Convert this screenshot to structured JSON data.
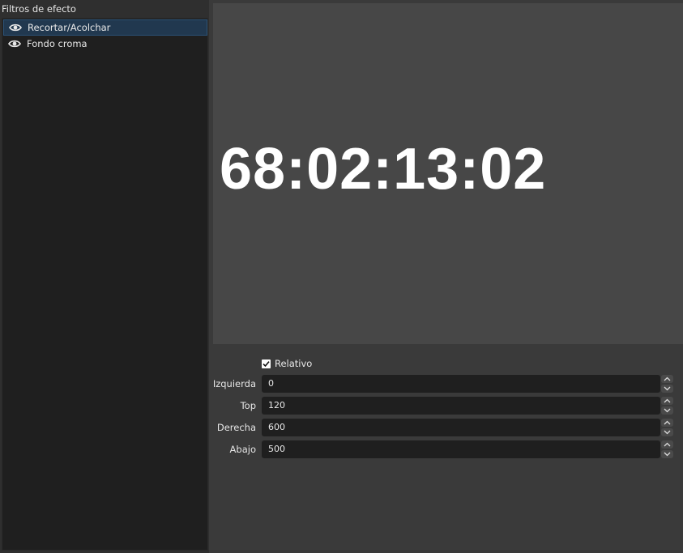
{
  "filters_panel": {
    "title": "Filtros de efecto",
    "items": [
      {
        "label": "Recortar/Acolchar",
        "selected": true,
        "icon": "eye-icon"
      },
      {
        "label": "Fondo croma",
        "selected": false,
        "icon": "eye-icon"
      }
    ]
  },
  "preview": {
    "timecode": "68:02:13:02"
  },
  "properties": {
    "relative": {
      "label": "Relativo",
      "checked": true
    },
    "fields": [
      {
        "label": "Izquierda",
        "value": "0"
      },
      {
        "label": "Top",
        "value": "120"
      },
      {
        "label": "Derecha",
        "value": "600"
      },
      {
        "label": "Abajo",
        "value": "500"
      }
    ]
  },
  "colors": {
    "selection": "#21384f",
    "background": "#3a3a3a",
    "list_background": "#1f1f1f",
    "preview_background": "#474747"
  }
}
